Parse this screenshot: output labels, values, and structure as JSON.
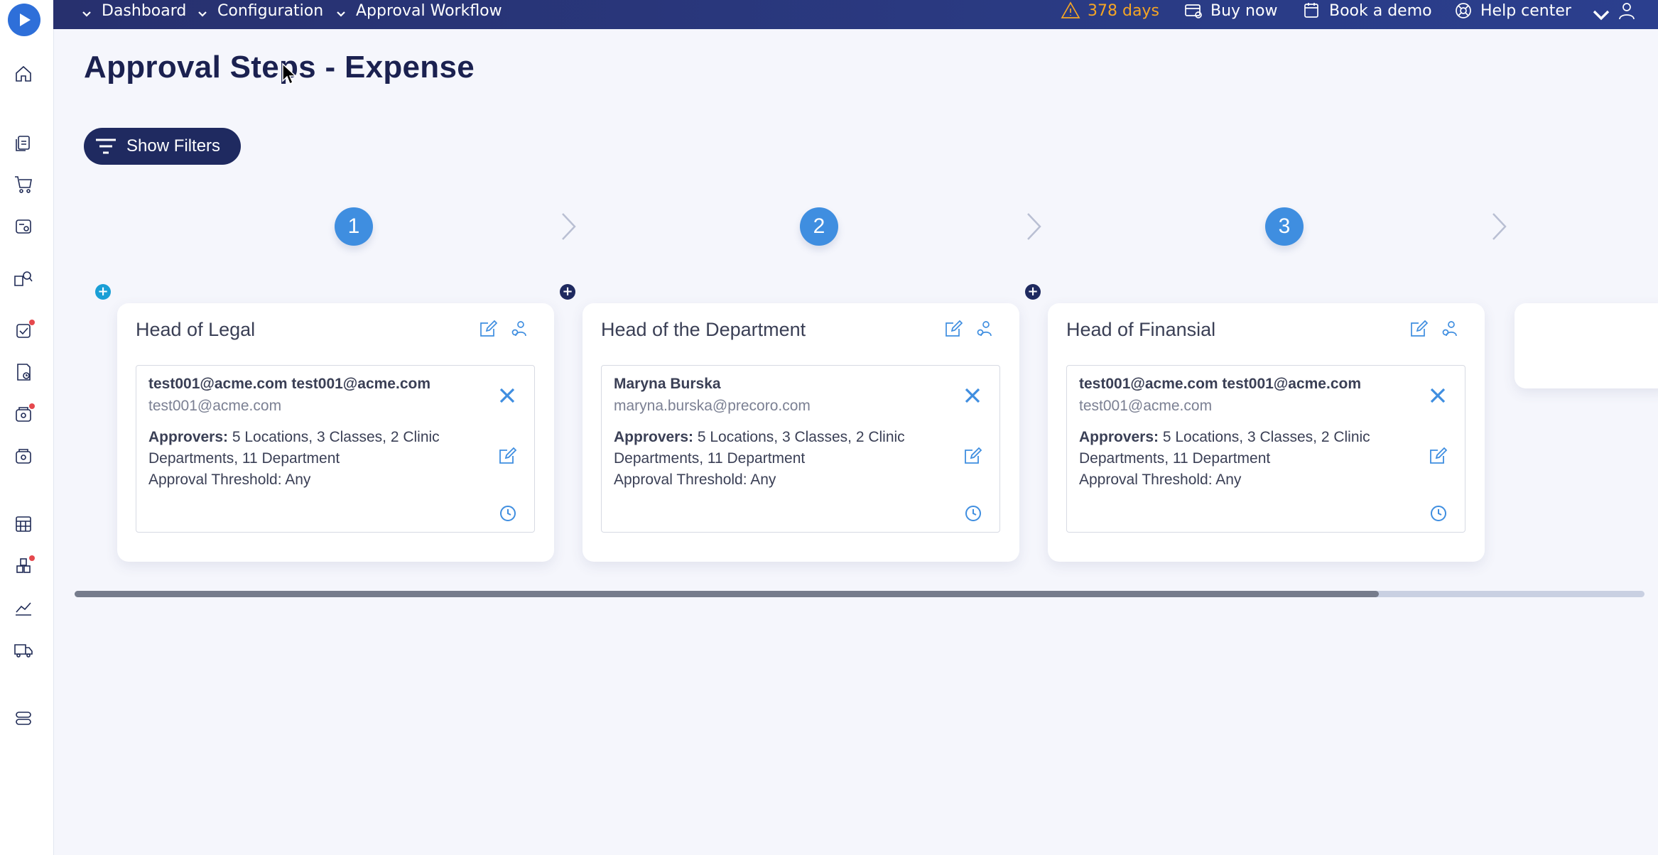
{
  "breadcrumbs": [
    "Dashboard",
    "Configuration",
    "Approval Workflow"
  ],
  "topbar": {
    "trial_days": "378 days",
    "buy_now": "Buy now",
    "book_demo": "Book a demo",
    "help_center": "Help center"
  },
  "sidebar": {
    "icons": [
      "home-icon",
      "documents-icon",
      "cart-icon",
      "invoice-icon",
      "supplier-search-icon",
      "approvals-icon",
      "receipt-icon",
      "budget-icon",
      "payment-icon",
      "calculator-icon",
      "inventory-icon",
      "analytics-icon",
      "delivery-icon",
      "settings-icon"
    ]
  },
  "page": {
    "title": "Approval Steps - Expense",
    "filters_label": "Show Filters"
  },
  "steps": [
    {
      "number": "1",
      "title": "Head of Legal",
      "approver": {
        "name": "test001@acme.com test001@acme.com",
        "email": "test001@acme.com",
        "approvers_label": "Approvers:",
        "approvers_value": " 5 Locations, 3 Classes, 2 Clinic Departments, 11 Department",
        "threshold": "Approval Threshold: Any"
      }
    },
    {
      "number": "2",
      "title": "Head of the Department",
      "approver": {
        "name": "Maryna Burska",
        "email": "maryna.burska@precoro.com",
        "approvers_label": "Approvers:",
        "approvers_value": " 5 Locations, 3 Classes, 2 Clinic Departments, 11 Department",
        "threshold": "Approval Threshold: Any"
      }
    },
    {
      "number": "3",
      "title": "Head of Finansial",
      "approver": {
        "name": "test001@acme.com test001@acme.com",
        "email": "test001@acme.com",
        "approvers_label": "Approvers:",
        "approvers_value": " 5 Locations, 3 Classes, 2 Clinic Departments, 11 Department",
        "threshold": "Approval Threshold: Any"
      }
    }
  ],
  "colors": {
    "topbar": "#27306e",
    "accent": "#3f8ee0",
    "warning": "#f5a524",
    "add_first": "#1a9fd6",
    "add_other": "#1f2a60"
  }
}
